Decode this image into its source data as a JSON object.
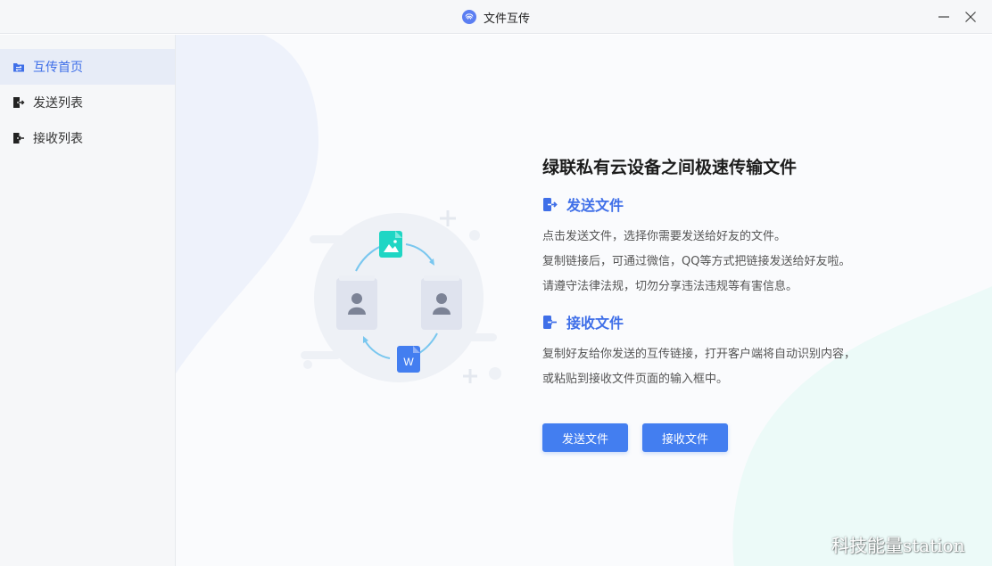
{
  "window": {
    "title": "文件互传",
    "icon": "fingerprint-app-icon"
  },
  "sidebar": {
    "items": [
      {
        "label": "互传首页",
        "icon": "home-transfer-icon",
        "active": true
      },
      {
        "label": "发送列表",
        "icon": "send-list-icon",
        "active": false
      },
      {
        "label": "接收列表",
        "icon": "receive-list-icon",
        "active": false
      }
    ]
  },
  "main": {
    "headline": "绿联私有云设备之间极速传输文件",
    "send": {
      "title": "发送文件",
      "lines": [
        "点击发送文件，选择你需要发送给好友的文件。",
        "复制链接后，可通过微信，QQ等方式把链接发送给好友啦。",
        "请遵守法律法规，切勿分享违法违规等有害信息。"
      ]
    },
    "receive": {
      "title": "接收文件",
      "lines": [
        "复制好友给你发送的互传链接，打开客户端将自动识别内容，",
        "或粘贴到接收文件页面的输入框中。"
      ]
    },
    "buttons": {
      "send": "发送文件",
      "receive": "接收文件"
    },
    "illustration": {
      "doc_badge": "W"
    }
  },
  "watermark": "科技能量station",
  "colors": {
    "accent": "#437ef0",
    "active_bg": "#e7ecf7",
    "teal": "#1fd6c4"
  }
}
